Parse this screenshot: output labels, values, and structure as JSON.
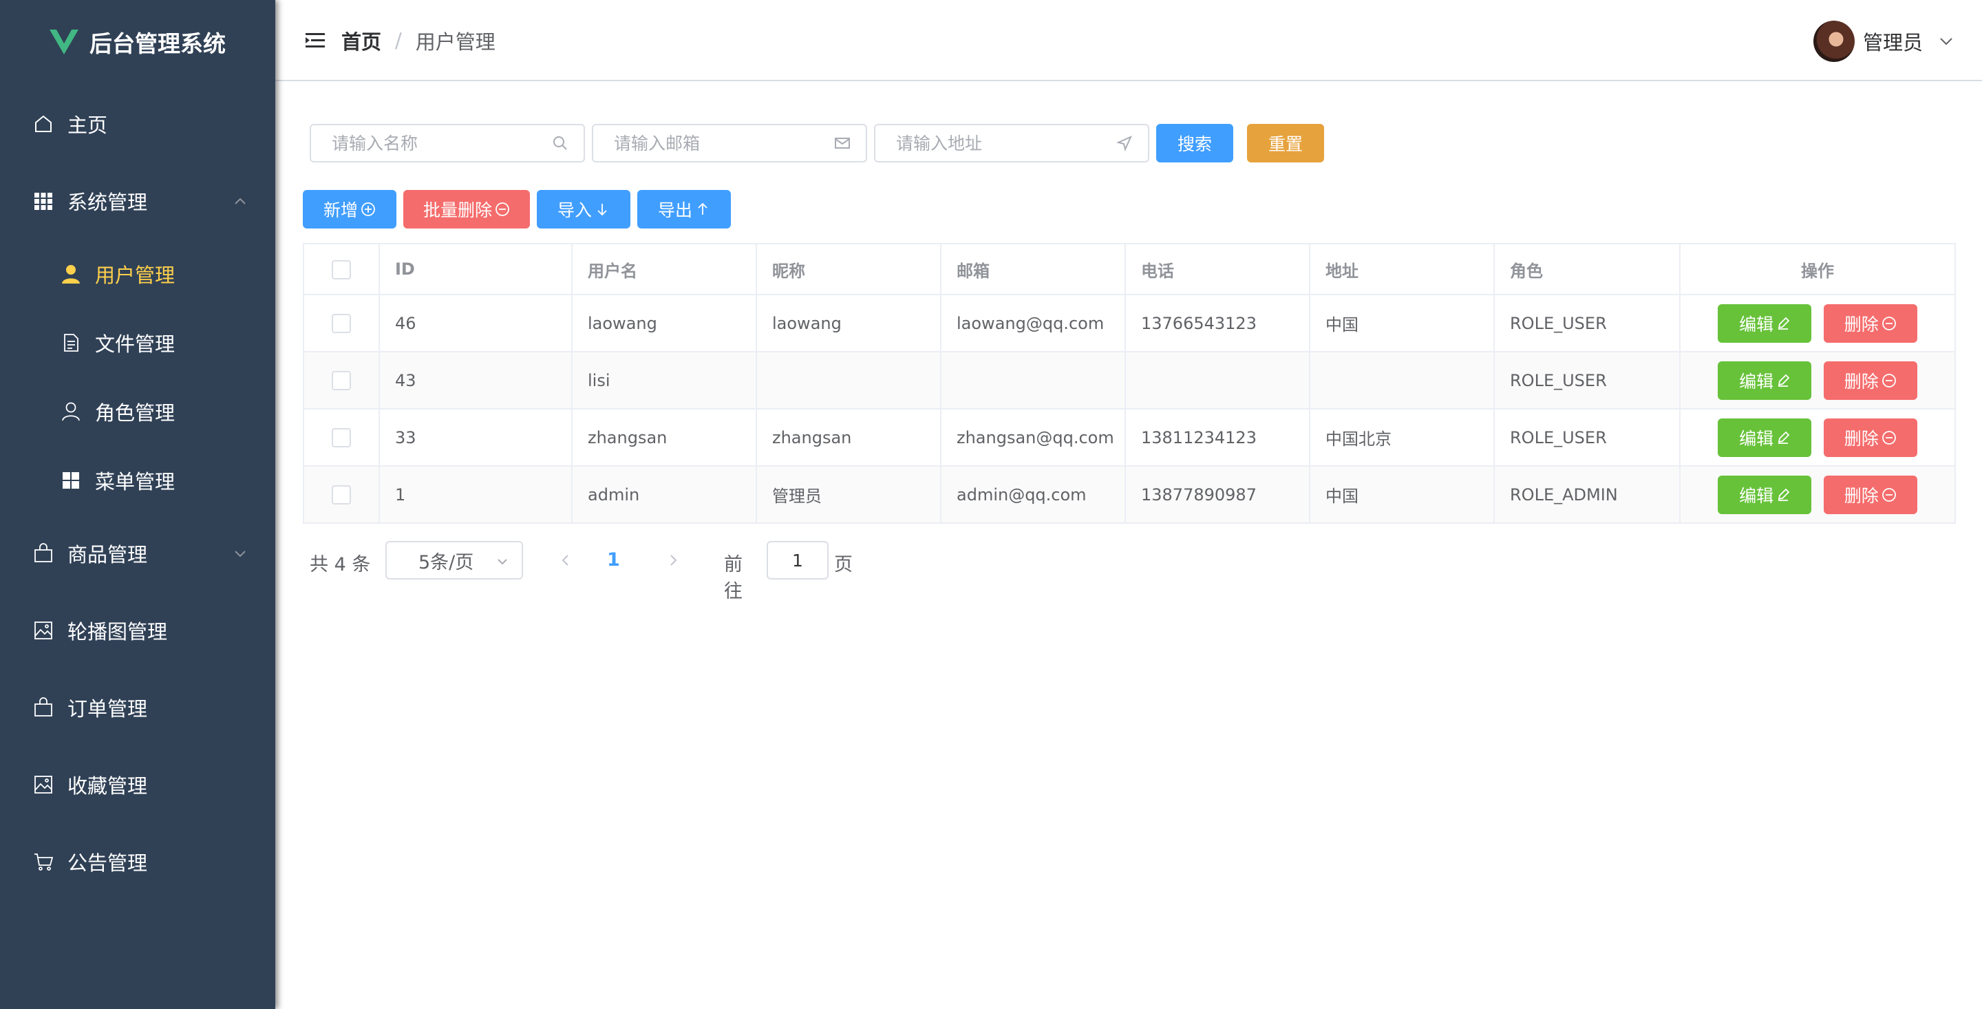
{
  "app": {
    "title": "后台管理系统"
  },
  "sidebar": {
    "items": [
      {
        "label": "主页",
        "icon": "home-icon"
      },
      {
        "label": "系统管理",
        "icon": "grid-icon",
        "expanded": true
      },
      {
        "label": "用户管理",
        "icon": "user-fill-icon",
        "active": true
      },
      {
        "label": "文件管理",
        "icon": "document-icon"
      },
      {
        "label": "角色管理",
        "icon": "user-outline-icon"
      },
      {
        "label": "菜单管理",
        "icon": "menu-grid-icon"
      },
      {
        "label": "商品管理",
        "icon": "bag-icon",
        "expanded": false
      },
      {
        "label": "轮播图管理",
        "icon": "picture-icon"
      },
      {
        "label": "订单管理",
        "icon": "bag-icon"
      },
      {
        "label": "收藏管理",
        "icon": "picture-icon"
      },
      {
        "label": "公告管理",
        "icon": "cart-icon"
      }
    ]
  },
  "header": {
    "breadcrumb": {
      "home": "首页",
      "separator": "/",
      "current": "用户管理"
    },
    "user": {
      "name": "管理员"
    }
  },
  "search": {
    "name_placeholder": "请输入名称",
    "email_placeholder": "请输入邮箱",
    "address_placeholder": "请输入地址",
    "search_label": "搜索",
    "reset_label": "重置"
  },
  "toolbar": {
    "add_label": "新增",
    "batch_delete_label": "批量删除",
    "import_label": "导入",
    "export_label": "导出"
  },
  "table": {
    "columns": [
      "ID",
      "用户名",
      "昵称",
      "邮箱",
      "电话",
      "地址",
      "角色",
      "操作"
    ],
    "rows": [
      {
        "id": "46",
        "username": "laowang",
        "nickname": "laowang",
        "email": "laowang@qq.com",
        "phone": "13766543123",
        "address": "中国",
        "role": "ROLE_USER"
      },
      {
        "id": "43",
        "username": "lisi",
        "nickname": "",
        "email": "",
        "phone": "",
        "address": "",
        "role": "ROLE_USER"
      },
      {
        "id": "33",
        "username": "zhangsan",
        "nickname": "zhangsan",
        "email": "zhangsan@qq.com",
        "phone": "13811234123",
        "address": "中国北京",
        "role": "ROLE_USER"
      },
      {
        "id": "1",
        "username": "admin",
        "nickname": "管理员",
        "email": "admin@qq.com",
        "phone": "13877890987",
        "address": "中国",
        "role": "ROLE_ADMIN"
      }
    ],
    "edit_label": "编辑",
    "delete_label": "删除"
  },
  "pagination": {
    "total_text": "共 4 条",
    "page_size": "5条/页",
    "current_page": "1",
    "goto_prefix": "前往",
    "goto_value": "1",
    "goto_suffix": "页"
  },
  "colors": {
    "sidebar_bg": "#304156",
    "active_menu": "#ffd04b",
    "primary": "#409eff",
    "warning": "#e6a23c",
    "danger": "#f56c6c",
    "success": "#67c23a"
  }
}
